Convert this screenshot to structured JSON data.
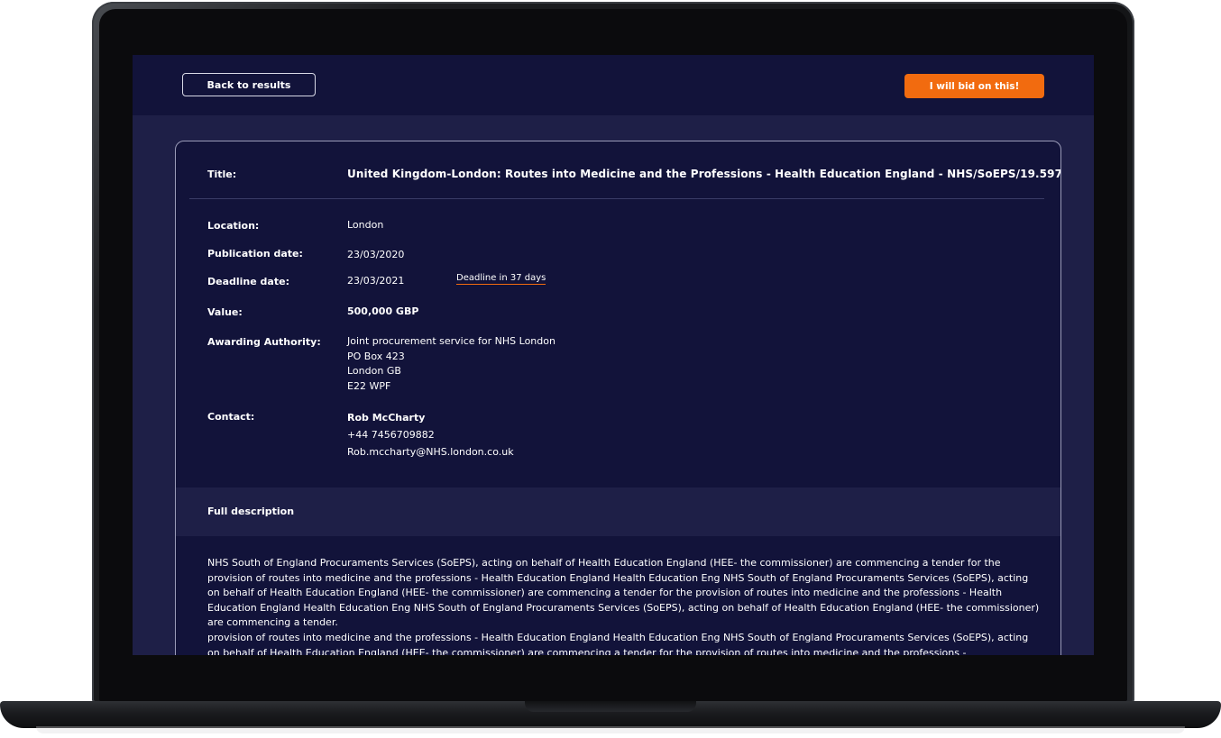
{
  "topbar": {
    "back_label": "Back to results",
    "bid_label": "I will bid on this!"
  },
  "details": {
    "title_label": "Title:",
    "title_value": "United Kingdom-London: Routes into Medicine and the Professions - Health Education England - NHS/SoEPS/19.597",
    "location_label": "Location:",
    "location_value": "London",
    "publication_label": "Publication date:",
    "publication_value": "23/03/2020",
    "deadline_label": "Deadline date:",
    "deadline_value": "23/03/2021",
    "deadline_badge": "Deadline in 37 days",
    "value_label": "Value:",
    "value_value": "500,000 GBP",
    "authority_label": "Awarding Authority:",
    "authority_lines": [
      "Joint procurement service for NHS London",
      "PO Box 423",
      "London GB",
      "E22 WPF"
    ],
    "contact_label": "Contact:",
    "contact_name": "Rob McCharty",
    "contact_phone": "+44 7456709882",
    "contact_email": "Rob.mccharty@NHS.london.co.uk"
  },
  "description": {
    "header": "Full description",
    "paragraph_1": "NHS South of England Procuraments Services (SoEPS), acting on behalf of Health Education England (HEE- the commissioner) are commencing a tender for the provision of routes into medicine and the professions - Health Education England Health Education Eng NHS South of England Procuraments Services (SoEPS), acting on behalf of Health Education England (HEE- the commissioner) are commencing a tender for the provision of routes into medicine and the professions - Health Education England Health Education Eng NHS South of England Procuraments Services (SoEPS), acting on behalf of Health Education England (HEE- the commissioner) are commencing a tender.",
    "paragraph_2": "provision of routes into medicine and the professions - Health Education England Health Education Eng NHS South of England Procuraments Services (SoEPS), acting on behalf of Health Education England (HEE- the commissioner) are commencing a tender for the provision of routes into medicine and the professions -"
  }
}
